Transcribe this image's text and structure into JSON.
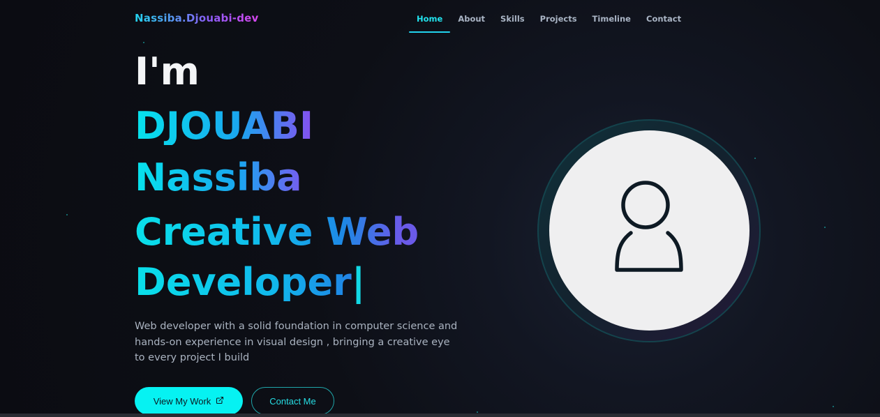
{
  "brand": {
    "logo": "Nassiba.Djouabi-dev"
  },
  "nav": {
    "items": [
      {
        "label": "Home",
        "active": true
      },
      {
        "label": "About"
      },
      {
        "label": "Skills"
      },
      {
        "label": "Projects"
      },
      {
        "label": "Timeline"
      },
      {
        "label": "Contact"
      }
    ]
  },
  "hero": {
    "intro": "I'm",
    "surname": "DJOUABI",
    "firstname": "Nassiba",
    "role_line1": "Creative Web",
    "role_line2": "Developer",
    "cursor": "|",
    "description": "Web developer with a solid foundation in computer science and hands-on experience in visual design , bringing a creative eye to every project I build",
    "primary_button": "View My Work",
    "secondary_button": "Contact Me"
  },
  "icons": {
    "external_link": "external-link-icon",
    "avatar": "user-icon"
  },
  "colors": {
    "accent": "#06f2f2",
    "background": "#0c0e14",
    "gradient_start": "#06e3ec",
    "gradient_end": "#8b4cf0"
  }
}
